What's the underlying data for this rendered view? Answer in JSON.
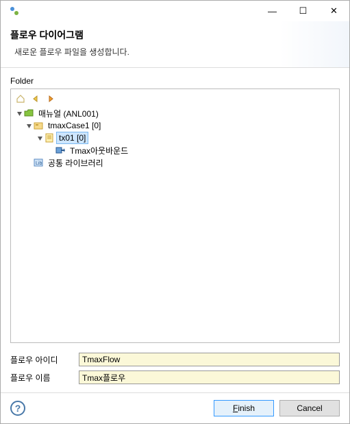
{
  "titlebar": {
    "minimize": "—",
    "maximize": "☐",
    "close": "✕"
  },
  "header": {
    "title": "플로우 다이어그램",
    "desc": "새로운 플로우 파일을 생성합니다."
  },
  "folder": {
    "label": "Folder",
    "toolbar": {
      "home": "⌂",
      "back": "⇦",
      "forward": "⇨"
    },
    "tree": {
      "root": {
        "label": "매뉴얼  (ANL001)",
        "children": {
          "case": {
            "label": "tmaxCase1 [0]",
            "children": {
              "tx": {
                "label": "tx01 [0]",
                "children": {
                  "outbound": {
                    "label": "Tmax아웃바운드"
                  }
                }
              }
            }
          },
          "lib": {
            "label": "공통 라이브러리"
          }
        }
      }
    }
  },
  "fields": {
    "flowId": {
      "label": "플로우 아이디",
      "value": "TmaxFlow"
    },
    "flowName": {
      "label": "플로우 이름",
      "value": "Tmax플로우"
    }
  },
  "footer": {
    "help": "?",
    "finish_prefix": "F",
    "finish_rest": "inish",
    "cancel": "Cancel"
  }
}
